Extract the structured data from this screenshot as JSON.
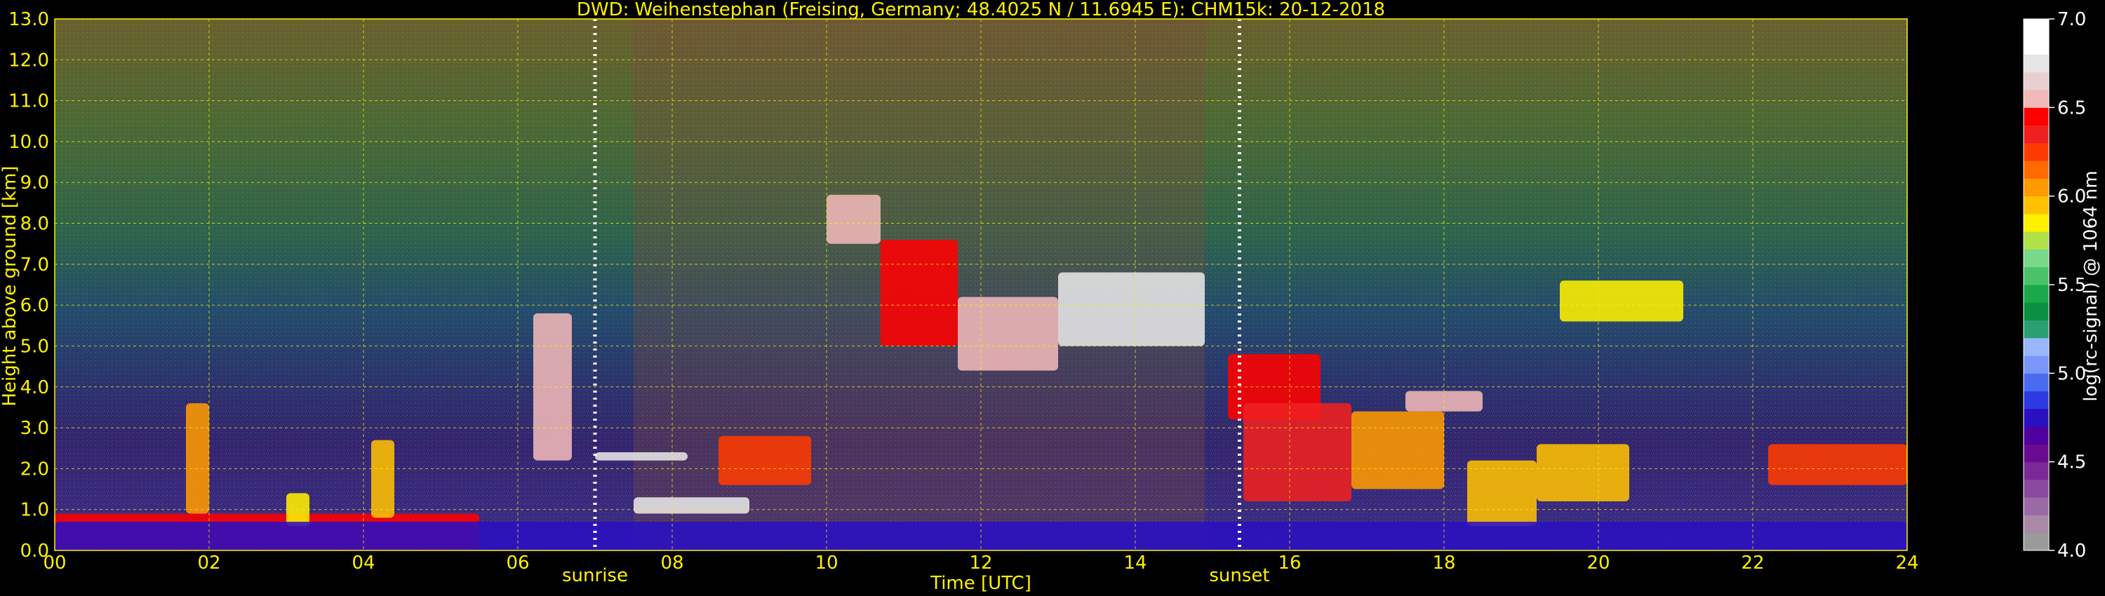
{
  "colors": {
    "label": "#FFF200",
    "grid": "#FFF200",
    "background": "#000000",
    "colorbar_text": "#FFFFFF"
  },
  "chart_data": {
    "type": "heatmap",
    "title": "DWD: Weihenstephan (Freising, Germany; 48.4025 N / 11.6945 E):    CHM15k: 20-12-2018",
    "xlabel": "Time [UTC]",
    "ylabel": "Height above ground [km]",
    "xlim": [
      0,
      24
    ],
    "ylim": [
      0,
      13
    ],
    "grid": true,
    "x_ticks": [
      "00",
      "02",
      "04",
      "06",
      "08",
      "10",
      "12",
      "14",
      "16",
      "18",
      "20",
      "22",
      "24"
    ],
    "y_ticks": [
      "0.0",
      "1.0",
      "2.0",
      "3.0",
      "4.0",
      "5.0",
      "6.0",
      "7.0",
      "8.0",
      "9.0",
      "10.0",
      "11.0",
      "12.0",
      "13.0"
    ],
    "events": [
      {
        "label": "sunrise",
        "x": 7.0
      },
      {
        "label": "sunset",
        "x": 15.35
      }
    ],
    "colorbar": {
      "label": "log(rc-signal) @ 1064 nm",
      "range": [
        4.0,
        7.0
      ],
      "ticks": [
        "4.0",
        "4.5",
        "5.0",
        "5.5",
        "6.0",
        "6.5",
        "7.0"
      ],
      "colors": [
        "#9A9A9A",
        "#A88AA6",
        "#9A6AA6",
        "#8A4A9E",
        "#7A2A96",
        "#6A0A90",
        "#5000A0",
        "#2A10C0",
        "#2A3AE0",
        "#4A6AF0",
        "#7A96FA",
        "#9AB6FC",
        "#2AA070",
        "#0A9040",
        "#1AA84A",
        "#4AC26A",
        "#7AD88A",
        "#B0E04A",
        "#FFF000",
        "#FFC000",
        "#FF9A00",
        "#FF6A00",
        "#FF3A00",
        "#F02020",
        "#FF0000",
        "#F0B8B8",
        "#E8D0D0",
        "#E6E6E6",
        "#FFFFFF",
        "#FFFFFF"
      ]
    },
    "cloud_layers": [
      {
        "x_start": 0.0,
        "x_end": 5.5,
        "y_bottom": 0.0,
        "y_top": 0.9,
        "value": 6.4
      },
      {
        "x_start": 1.7,
        "x_end": 2.0,
        "y_bottom": 0.9,
        "y_top": 3.6,
        "value": 6.0
      },
      {
        "x_start": 3.0,
        "x_end": 3.3,
        "y_bottom": 0.6,
        "y_top": 1.4,
        "value": 5.8
      },
      {
        "x_start": 4.1,
        "x_end": 4.4,
        "y_bottom": 0.8,
        "y_top": 2.7,
        "value": 5.9
      },
      {
        "x_start": 6.2,
        "x_end": 6.7,
        "y_bottom": 2.2,
        "y_top": 5.8,
        "value": 6.5
      },
      {
        "x_start": 7.0,
        "x_end": 8.2,
        "y_bottom": 2.2,
        "y_top": 2.4,
        "value": 6.8
      },
      {
        "x_start": 7.5,
        "x_end": 9.0,
        "y_bottom": 0.9,
        "y_top": 1.3,
        "value": 6.8
      },
      {
        "x_start": 8.6,
        "x_end": 9.8,
        "y_bottom": 1.6,
        "y_top": 2.8,
        "value": 6.2
      },
      {
        "x_start": 10.0,
        "x_end": 10.7,
        "y_bottom": 7.5,
        "y_top": 8.7,
        "value": 6.6
      },
      {
        "x_start": 10.7,
        "x_end": 11.7,
        "y_bottom": 5.0,
        "y_top": 7.6,
        "value": 6.4
      },
      {
        "x_start": 11.7,
        "x_end": 13.0,
        "y_bottom": 4.4,
        "y_top": 6.2,
        "value": 6.5
      },
      {
        "x_start": 13.0,
        "x_end": 14.9,
        "y_bottom": 5.0,
        "y_top": 6.8,
        "value": 6.7
      },
      {
        "x_start": 15.2,
        "x_end": 16.4,
        "y_bottom": 3.2,
        "y_top": 4.8,
        "value": 6.4
      },
      {
        "x_start": 15.4,
        "x_end": 16.8,
        "y_bottom": 1.2,
        "y_top": 3.6,
        "value": 6.3
      },
      {
        "x_start": 16.8,
        "x_end": 18.0,
        "y_bottom": 1.5,
        "y_top": 3.4,
        "value": 6.1
      },
      {
        "x_start": 17.5,
        "x_end": 18.5,
        "y_bottom": 3.4,
        "y_top": 3.9,
        "value": 6.6
      },
      {
        "x_start": 18.3,
        "x_end": 19.2,
        "y_bottom": 0.6,
        "y_top": 2.2,
        "value": 5.9
      },
      {
        "x_start": 19.2,
        "x_end": 20.4,
        "y_bottom": 1.2,
        "y_top": 2.6,
        "value": 5.9
      },
      {
        "x_start": 19.5,
        "x_end": 21.1,
        "y_bottom": 5.6,
        "y_top": 6.6,
        "value": 5.8
      },
      {
        "x_start": 22.2,
        "x_end": 24.0,
        "y_bottom": 1.6,
        "y_top": 2.6,
        "value": 6.2
      },
      {
        "x_start": 0.0,
        "x_end": 24.0,
        "y_bottom": 0.0,
        "y_top": 0.7,
        "value": 4.8
      }
    ]
  }
}
